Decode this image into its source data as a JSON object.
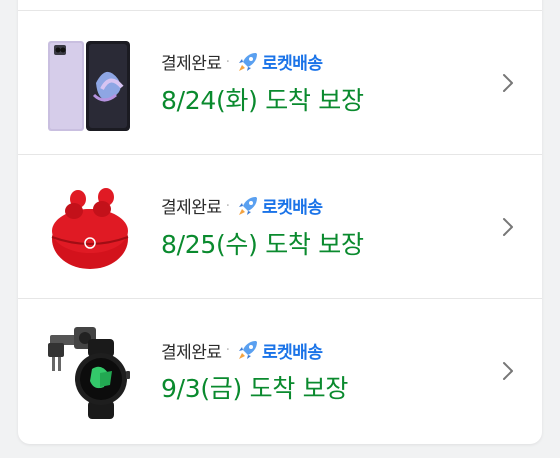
{
  "orders": [
    {
      "status": "결제완료",
      "separator": "·",
      "shipping": "로켓배송",
      "arrival": "8/24(화) 도착 보장",
      "product_icon": "phone-icon"
    },
    {
      "status": "결제완료",
      "separator": "·",
      "shipping": "로켓배송",
      "arrival": "8/25(수) 도착 보장",
      "product_icon": "earbuds-icon"
    },
    {
      "status": "결제완료",
      "separator": "·",
      "shipping": "로켓배송",
      "arrival": "9/3(금) 도착 보장",
      "product_icon": "watch-icon"
    }
  ],
  "colors": {
    "arrival": "#0a8a2e",
    "rocket": "#1a73e8",
    "status": "#2b2b2b"
  }
}
